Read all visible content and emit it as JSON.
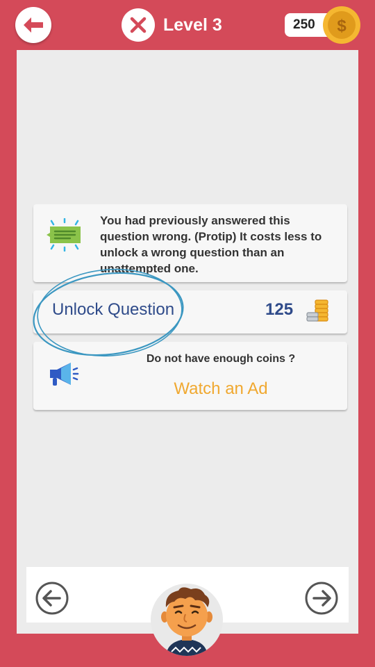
{
  "header": {
    "level_title": "Level 3",
    "coin_count": "250",
    "coin_symbol": "$",
    "back_icon": "back-arrow-icon",
    "status_icon": "wrong-x-icon"
  },
  "info_card": {
    "message": "You had previously answered this question wrong. (Protip) It costs less to unlock a wrong question than an unattempted one.",
    "icon": "message-icon"
  },
  "unlock_card": {
    "label": "Unlock Question",
    "cost": "125",
    "icon": "coin-stack-icon"
  },
  "ad_card": {
    "question": "Do not have enough coins ?",
    "action": "Watch an Ad",
    "icon": "megaphone-icon"
  },
  "bottom_nav": {
    "prev_icon": "arrow-left-circle-icon",
    "next_icon": "arrow-right-circle-icon",
    "avatar": "avatar-man-smiling"
  },
  "colors": {
    "background": "#d44a59",
    "panel": "#ececec",
    "accent_blue": "#2f4b8a",
    "accent_orange": "#f0a830",
    "annotation": "#3b97c1"
  }
}
